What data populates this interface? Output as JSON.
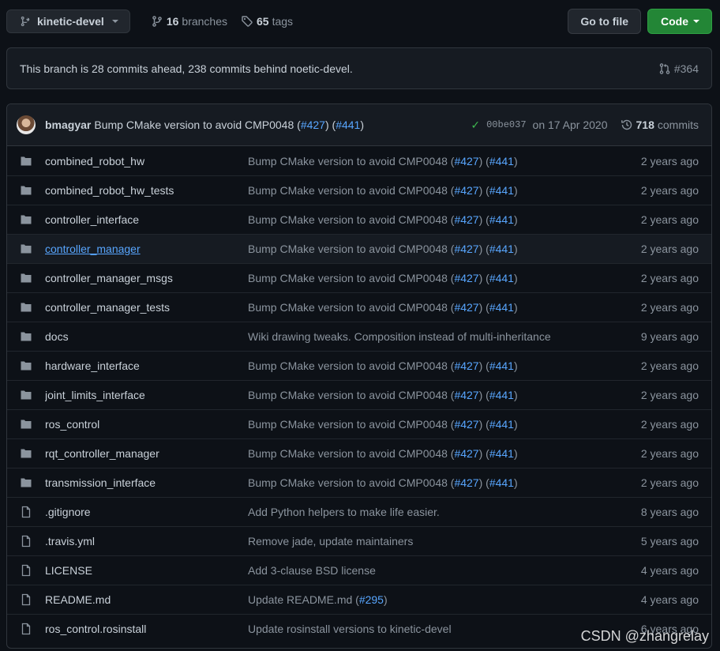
{
  "toolbar": {
    "branch_label": "kinetic-devel",
    "branches_count": "16",
    "branches_label": "branches",
    "tags_count": "65",
    "tags_label": "tags",
    "go_to_file_label": "Go to file",
    "code_label": "Code"
  },
  "branch_status": {
    "text": "This branch is 28 commits ahead, 238 commits behind noetic-devel.",
    "pr_label": "#364"
  },
  "latest_commit": {
    "author": "bmagyar",
    "message": "Bump CMake version to avoid CMP0048 (",
    "ref1": "#427",
    "mid": ") (",
    "ref2": "#441",
    "end": ")",
    "sha": "00be037",
    "date": "on 17 Apr 2020",
    "commits_count": "718",
    "commits_label": "commits"
  },
  "files": [
    {
      "type": "dir",
      "name": "combined_robot_hw",
      "msg": "Bump CMake version to avoid CMP0048 (",
      "r1": "#427",
      "mid": ") (",
      "r2": "#441",
      "end": ")",
      "age": "2 years ago"
    },
    {
      "type": "dir",
      "name": "combined_robot_hw_tests",
      "msg": "Bump CMake version to avoid CMP0048 (",
      "r1": "#427",
      "mid": ") (",
      "r2": "#441",
      "end": ")",
      "age": "2 years ago"
    },
    {
      "type": "dir",
      "name": "controller_interface",
      "msg": "Bump CMake version to avoid CMP0048 (",
      "r1": "#427",
      "mid": ") (",
      "r2": "#441",
      "end": ")",
      "age": "2 years ago"
    },
    {
      "type": "dir",
      "name": "controller_manager",
      "msg": "Bump CMake version to avoid CMP0048 (",
      "r1": "#427",
      "mid": ") (",
      "r2": "#441",
      "end": ")",
      "age": "2 years ago"
    },
    {
      "type": "dir",
      "name": "controller_manager_msgs",
      "msg": "Bump CMake version to avoid CMP0048 (",
      "r1": "#427",
      "mid": ") (",
      "r2": "#441",
      "end": ")",
      "age": "2 years ago"
    },
    {
      "type": "dir",
      "name": "controller_manager_tests",
      "msg": "Bump CMake version to avoid CMP0048 (",
      "r1": "#427",
      "mid": ") (",
      "r2": "#441",
      "end": ")",
      "age": "2 years ago"
    },
    {
      "type": "dir",
      "name": "docs",
      "msg": "Wiki drawing tweaks. Composition instead of multi-inheritance",
      "r1": "",
      "mid": "",
      "r2": "",
      "end": "",
      "age": "9 years ago"
    },
    {
      "type": "dir",
      "name": "hardware_interface",
      "msg": "Bump CMake version to avoid CMP0048 (",
      "r1": "#427",
      "mid": ") (",
      "r2": "#441",
      "end": ")",
      "age": "2 years ago"
    },
    {
      "type": "dir",
      "name": "joint_limits_interface",
      "msg": "Bump CMake version to avoid CMP0048 (",
      "r1": "#427",
      "mid": ") (",
      "r2": "#441",
      "end": ")",
      "age": "2 years ago"
    },
    {
      "type": "dir",
      "name": "ros_control",
      "msg": "Bump CMake version to avoid CMP0048 (",
      "r1": "#427",
      "mid": ") (",
      "r2": "#441",
      "end": ")",
      "age": "2 years ago"
    },
    {
      "type": "dir",
      "name": "rqt_controller_manager",
      "msg": "Bump CMake version to avoid CMP0048 (",
      "r1": "#427",
      "mid": ") (",
      "r2": "#441",
      "end": ")",
      "age": "2 years ago"
    },
    {
      "type": "dir",
      "name": "transmission_interface",
      "msg": "Bump CMake version to avoid CMP0048 (",
      "r1": "#427",
      "mid": ") (",
      "r2": "#441",
      "end": ")",
      "age": "2 years ago"
    },
    {
      "type": "file",
      "name": ".gitignore",
      "msg": "Add Python helpers to make life easier.",
      "r1": "",
      "mid": "",
      "r2": "",
      "end": "",
      "age": "8 years ago"
    },
    {
      "type": "file",
      "name": ".travis.yml",
      "msg": "Remove jade, update maintainers",
      "r1": "",
      "mid": "",
      "r2": "",
      "end": "",
      "age": "5 years ago"
    },
    {
      "type": "file",
      "name": "LICENSE",
      "msg": "Add 3-clause BSD license",
      "r1": "",
      "mid": "",
      "r2": "",
      "end": "",
      "age": "4 years ago"
    },
    {
      "type": "file",
      "name": "README.md",
      "msg": "Update README.md (",
      "r1": "#295",
      "mid": ")",
      "r2": "",
      "end": "",
      "age": "4 years ago"
    },
    {
      "type": "file",
      "name": "ros_control.rosinstall",
      "msg": "Update rosinstall versions to kinetic-devel",
      "r1": "",
      "mid": "",
      "r2": "",
      "end": "",
      "age": "6 years ago"
    }
  ],
  "hovered_row_index": 3,
  "watermark": "CSDN @zhangrelay",
  "colors": {
    "background": "#0d1117",
    "panel": "#161b22",
    "border": "#30363d",
    "link": "#58a6ff",
    "code_button": "#238636",
    "check": "#3fb950"
  }
}
